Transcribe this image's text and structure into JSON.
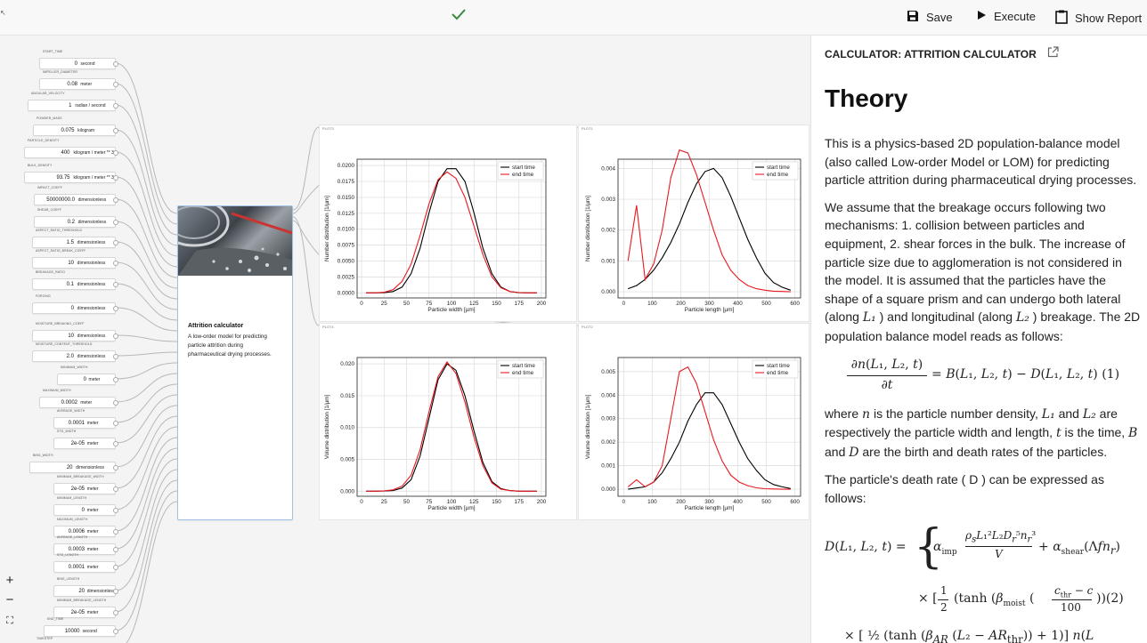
{
  "toolbar": {
    "status_icon": "checkmark-icon",
    "save_label": "Save",
    "execute_label": "Execute",
    "report_label": "Show Report"
  },
  "inputs": [
    {
      "label": "START_TIME",
      "value": "0",
      "unit": "second"
    },
    {
      "label": "IMPELLER_DIAMETER",
      "value": "0.08",
      "unit": "meter"
    },
    {
      "label": "ANGULAR_VELOCITY",
      "value": "1",
      "unit": "radian / second"
    },
    {
      "label": "POWDER_MASS",
      "value": "0.075",
      "unit": "kilogram"
    },
    {
      "label": "PARTICLE_DENSITY",
      "value": "400",
      "unit": "kilogram / meter ** 3"
    },
    {
      "label": "BULK_DENSITY",
      "value": "93.75",
      "unit": "kilogram / meter ** 3"
    },
    {
      "label": "IMPACT_COEFF",
      "value": "50000000.0",
      "unit": "dimensionless"
    },
    {
      "label": "SHEAR_COEFF",
      "value": "0.2",
      "unit": "dimensionless"
    },
    {
      "label": "ASPECT_RATIO_THRESHOLD",
      "value": "1.5",
      "unit": "dimensionless"
    },
    {
      "label": "ASPECT_RATIO_BREAK_COEFF",
      "value": "10",
      "unit": "dimensionless"
    },
    {
      "label": "BREAKAGE_RATIO",
      "value": "0.1",
      "unit": "dimensionless"
    },
    {
      "label": "FORCING",
      "value": "0",
      "unit": "dimensionless"
    },
    {
      "label": "MOISTURE_BREAKING_COEFF",
      "value": "10",
      "unit": "dimensionless"
    },
    {
      "label": "MOISTURE_CONTENT_THRESHOLD",
      "value": "2.0",
      "unit": "dimensionless"
    },
    {
      "label": "MINIMUM_WIDTH",
      "value": "0",
      "unit": "meter"
    },
    {
      "label": "MAXIMUM_WIDTH",
      "value": "0.0002",
      "unit": "meter"
    },
    {
      "label": "AVERAGE_WIDTH",
      "value": "0.0001",
      "unit": "meter"
    },
    {
      "label": "STD_WIDTH",
      "value": "2e-05",
      "unit": "meter"
    },
    {
      "label": "BINS_WIDTH",
      "value": "20",
      "unit": "dimensionless"
    },
    {
      "label": "MINIMUM_BREAKAGE_WIDTH",
      "value": "2e-05",
      "unit": "meter"
    },
    {
      "label": "MINIMUM_LENGTH",
      "value": "0",
      "unit": "meter"
    },
    {
      "label": "MAXIMUM_LENGTH",
      "value": "0.0006",
      "unit": "meter"
    },
    {
      "label": "AVERAGE_LENGTH",
      "value": "0.0003",
      "unit": "meter"
    },
    {
      "label": "STD_LENGTH",
      "value": "0.0001",
      "unit": "meter"
    },
    {
      "label": "BINS_LENGTH",
      "value": "20",
      "unit": "dimensionless"
    },
    {
      "label": "MINIMUM_BREAKAGE_LENGTH",
      "value": "2e-05",
      "unit": "meter"
    },
    {
      "label": "END_TIME",
      "value": "10000",
      "unit": "second"
    },
    {
      "label": "TIMESTEP",
      "value": "",
      "unit": ""
    }
  ],
  "calc_node": {
    "title": "Attrition calculator",
    "description": "A low-order model for predicting particle attrition during pharmaceutical drying processes."
  },
  "plots": [
    {
      "label": "PLOT3"
    },
    {
      "label": "PLOT1"
    },
    {
      "label": "PLOT4"
    },
    {
      "label": "PLOT2"
    }
  ],
  "colors": {
    "start": "#000000",
    "end": "#e8191f",
    "grid": "#dcdcdc"
  },
  "chart_data": [
    {
      "type": "line",
      "xlabel": "Particle width [µm]",
      "ylabel": "Number distribution [1/µm]",
      "xlim": [
        -5,
        205
      ],
      "ylim": [
        -0.0008,
        0.021
      ],
      "xticks": [
        0,
        25,
        50,
        75,
        100,
        125,
        150,
        175,
        200
      ],
      "yticks": [
        0,
        0.0025,
        0.005,
        0.0075,
        0.01,
        0.0125,
        0.015,
        0.0175,
        0.02
      ],
      "ytick_labels": [
        "0.0000",
        "0.0025",
        "0.0050",
        "0.0075",
        "0.0100",
        "0.0125",
        "0.0150",
        "0.0175",
        "0.0200"
      ],
      "x": [
        5,
        15,
        25,
        35,
        45,
        55,
        65,
        75,
        85,
        95,
        105,
        115,
        125,
        135,
        145,
        155,
        165,
        175,
        185,
        195
      ],
      "series": [
        {
          "name": "start time",
          "values": [
            0,
            0,
            2e-05,
            0.0002,
            0.0009,
            0.003,
            0.007,
            0.0126,
            0.0175,
            0.0195,
            0.0195,
            0.0175,
            0.0126,
            0.007,
            0.003,
            0.0009,
            0.0002,
            2e-05,
            0,
            0
          ]
        },
        {
          "name": "end time",
          "values": [
            0,
            0,
            0.0001,
            0.0005,
            0.0018,
            0.0045,
            0.009,
            0.014,
            0.0178,
            0.019,
            0.018,
            0.015,
            0.0105,
            0.006,
            0.0025,
            0.0008,
            0.0002,
            4e-05,
            0,
            0
          ]
        }
      ]
    },
    {
      "type": "line",
      "xlabel": "Particle length [µm]",
      "ylabel": "Number distribution [1/µm]",
      "xlim": [
        -20,
        620
      ],
      "ylim": [
        -0.0002,
        0.0043
      ],
      "xticks": [
        0,
        100,
        200,
        300,
        400,
        500,
        600
      ],
      "yticks": [
        0,
        0.001,
        0.002,
        0.003,
        0.004
      ],
      "ytick_labels": [
        "0.000",
        "0.001",
        "0.002",
        "0.003",
        "0.004"
      ],
      "x": [
        15,
        45,
        75,
        105,
        135,
        165,
        195,
        225,
        255,
        285,
        315,
        345,
        375,
        405,
        435,
        465,
        495,
        525,
        555,
        585
      ],
      "series": [
        {
          "name": "start time",
          "values": [
            0.0001,
            0.0002,
            0.0004,
            0.0007,
            0.0011,
            0.0016,
            0.0022,
            0.0029,
            0.0035,
            0.0039,
            0.004,
            0.0037,
            0.0031,
            0.0024,
            0.0017,
            0.0011,
            0.0006,
            0.0003,
            0.00015,
            5e-05
          ]
        },
        {
          "name": "end time",
          "values": [
            0.001,
            0.0028,
            0.0004,
            0.0009,
            0.002,
            0.0037,
            0.0046,
            0.0045,
            0.0038,
            0.0029,
            0.002,
            0.0012,
            0.0007,
            0.0004,
            0.0002,
            0.0001,
            5e-05,
            2e-05,
            1e-05,
            0
          ]
        }
      ]
    },
    {
      "type": "line",
      "xlabel": "Particle width [µm]",
      "ylabel": "Volume distribution [1/µm]",
      "xlim": [
        -5,
        205
      ],
      "ylim": [
        -0.0008,
        0.021
      ],
      "xticks": [
        0,
        25,
        50,
        75,
        100,
        125,
        150,
        175,
        200
      ],
      "yticks": [
        0,
        0.005,
        0.01,
        0.015,
        0.02
      ],
      "ytick_labels": [
        "0.000",
        "0.005",
        "0.010",
        "0.015",
        "0.020"
      ],
      "x": [
        5,
        15,
        25,
        35,
        45,
        55,
        65,
        75,
        85,
        95,
        105,
        115,
        125,
        135,
        145,
        155,
        165,
        175,
        185,
        195
      ],
      "series": [
        {
          "name": "start time",
          "values": [
            0,
            0,
            2e-05,
            0.0001,
            0.0005,
            0.0018,
            0.0055,
            0.0115,
            0.0175,
            0.02,
            0.019,
            0.015,
            0.0095,
            0.0045,
            0.0015,
            0.0004,
            0.0001,
            0,
            0,
            0
          ]
        },
        {
          "name": "end time",
          "values": [
            0,
            0,
            5e-05,
            0.0002,
            0.0008,
            0.0025,
            0.0065,
            0.0125,
            0.018,
            0.0203,
            0.0185,
            0.014,
            0.0085,
            0.004,
            0.0013,
            0.0003,
            0.0001,
            0,
            0,
            0
          ]
        }
      ]
    },
    {
      "type": "line",
      "xlabel": "Particle length [µm]",
      "ylabel": "Volume distribution [1/µm]",
      "xlim": [
        -20,
        620
      ],
      "ylim": [
        -0.0003,
        0.0056
      ],
      "xticks": [
        0,
        100,
        200,
        300,
        400,
        500,
        600
      ],
      "yticks": [
        0,
        0.001,
        0.002,
        0.003,
        0.004,
        0.005
      ],
      "ytick_labels": [
        "0.000",
        "0.001",
        "0.002",
        "0.003",
        "0.004",
        "0.005"
      ],
      "x": [
        15,
        45,
        75,
        105,
        135,
        165,
        195,
        225,
        255,
        285,
        315,
        345,
        375,
        405,
        435,
        465,
        495,
        525,
        555,
        585
      ],
      "series": [
        {
          "name": "start time",
          "values": [
            0,
            5e-05,
            0.0001,
            0.0003,
            0.0007,
            0.0013,
            0.002,
            0.0029,
            0.0036,
            0.0041,
            0.0041,
            0.0036,
            0.0028,
            0.002,
            0.0013,
            0.0008,
            0.0004,
            0.0002,
            0.0001,
            3e-05
          ]
        },
        {
          "name": "end time",
          "values": [
            0.0001,
            0.0004,
            0.0001,
            0.0003,
            0.001,
            0.003,
            0.005,
            0.0052,
            0.0045,
            0.0033,
            0.0021,
            0.0012,
            0.0006,
            0.0003,
            0.00015,
            6e-05,
            2e-05,
            1e-05,
            0,
            0
          ]
        }
      ]
    }
  ],
  "panel": {
    "calc_title": "CALCULATOR: ATTRITION CALCULATOR",
    "heading": "Theory",
    "p1": "This is a physics-based 2D population-balance model (also called Low-order Model or LOM) for predicting particle attrition during pharmaceutical drying processes.",
    "p2a": "We assume that the breakage occurs following two mechanisms: 1. collision between particles and equipment, 2. shear forces in the bulk. The increase of particle size due to agglomeration is not considered in the model. It is assumed that the particles have the shape of a square prism and can undergo both lateral (along ",
    "p2b": " ) and longitudinal (along ",
    "p2c": " ) breakage. The 2D population balance model reads as follows:",
    "L1": "L₁",
    "L2": "L₂",
    "eq_num": "(1)",
    "p3a": "where ",
    "p3b": " is the particle number density, ",
    "p3c": " and ",
    "p3d": " are respectively the particle width and length, ",
    "p3e": " is the time, ",
    "p3f": " and ",
    "p3g": " are the birth and death rates of the particles.",
    "n": "n",
    "t": "t",
    "B": "B",
    "D": "D",
    "p4": "The particle's death rate ( D ) can be expressed as follows:"
  }
}
